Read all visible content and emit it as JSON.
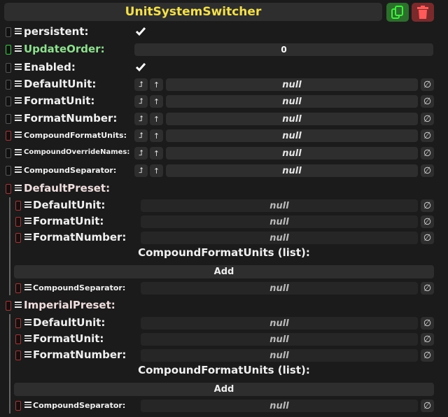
{
  "header": {
    "title": "UnitSystemSwitcher",
    "copy_icon": "copy-icon",
    "delete_icon": "trash-icon",
    "title_color": "#f3e04a"
  },
  "fields": {
    "persistent": {
      "label": "persistent:",
      "checked": true
    },
    "update_order": {
      "label": "UpdateOrder:",
      "value": "0"
    },
    "enabled": {
      "label": "Enabled:",
      "checked": true
    },
    "default_unit": {
      "label": "DefaultUnit:",
      "value": "null"
    },
    "format_unit": {
      "label": "FormatUnit:",
      "value": "null"
    },
    "format_number": {
      "label": "FormatNumber:",
      "value": "null"
    },
    "compound_format_units": {
      "label": "CompoundFormatUnits:",
      "value": "null"
    },
    "compound_override_names": {
      "label": "CompoundOverrideNames:",
      "value": "null"
    },
    "compound_separator": {
      "label": "CompoundSeparator:",
      "value": "null"
    }
  },
  "buttons": {
    "jump": "⮥",
    "up": "↑",
    "null": "∅",
    "add": "Add"
  },
  "default_preset": {
    "label": "DefaultPreset:",
    "default_unit": {
      "label": "DefaultUnit:",
      "value": "null"
    },
    "format_unit": {
      "label": "FormatUnit:",
      "value": "null"
    },
    "format_number": {
      "label": "FormatNumber:",
      "value": "null"
    },
    "list_header": "CompoundFormatUnits (list):",
    "add_label": "Add",
    "compound_separator": {
      "label": "CompoundSeparator:",
      "value": "null"
    }
  },
  "imperial_preset": {
    "label": "ImperialPreset:",
    "default_unit": {
      "label": "DefaultUnit:",
      "value": "null"
    },
    "format_unit": {
      "label": "FormatUnit:",
      "value": "null"
    },
    "format_number": {
      "label": "FormatNumber:",
      "value": "null"
    },
    "list_header": "CompoundFormatUnits (list):",
    "add_label": "Add",
    "compound_separator": {
      "label": "CompoundSeparator:",
      "value": "null"
    }
  }
}
